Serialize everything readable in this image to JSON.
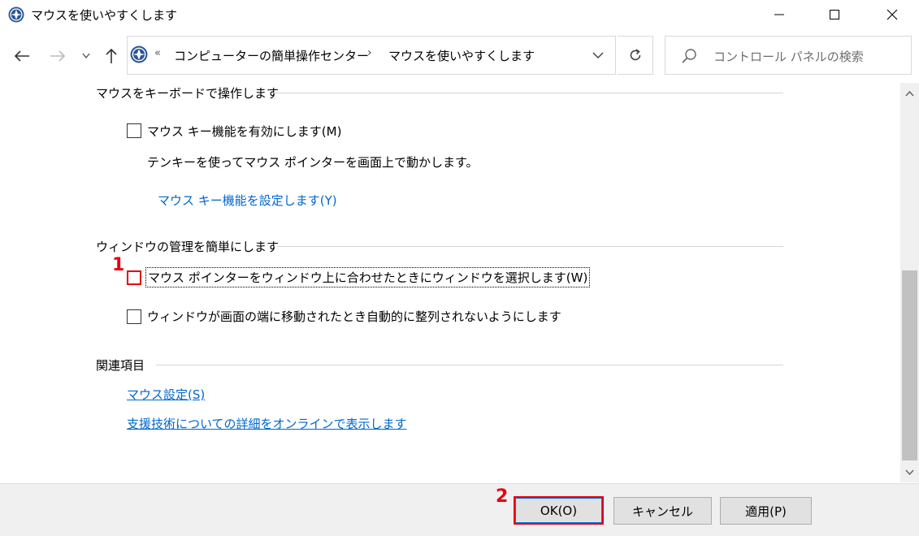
{
  "window": {
    "title": "マウスを使いやすくします",
    "controls": [
      "minimize-icon",
      "maximize-icon",
      "close-icon"
    ]
  },
  "nav": {
    "overflow": "«",
    "breadcrumbs": [
      "コンピューターの簡単操作センター",
      "マウスを使いやすくします"
    ],
    "separator": "›",
    "search_placeholder": "コントロール パネルの検索"
  },
  "sections": {
    "keyboard": {
      "title": "マウスをキーボードで操作します",
      "checkbox_label": "マウス キー機能を有効にします(M)",
      "checkbox_checked": false,
      "description": "テンキーを使ってマウス ポインターを画面上で動かします。",
      "setup_link": "マウス キー機能を設定します(Y)"
    },
    "window_mgmt": {
      "title": "ウィンドウの管理を簡単にします",
      "hover_label": "マウス ポインターをウィンドウ上に合わせたときにウィンドウを選択します(W)",
      "hover_checked": false,
      "snap_label": "ウィンドウが画面の端に移動されたとき自動的に整列されないようにします",
      "snap_checked": false
    },
    "related": {
      "title": "関連項目",
      "links": [
        "マウス設定(S)",
        "支援技術についての詳細をオンラインで表示します"
      ]
    }
  },
  "annotations": {
    "marker_1": "1",
    "marker_2": "2",
    "highlight_color": "#e60012"
  },
  "buttons": {
    "ok": "OK(O)",
    "cancel": "キャンセル",
    "apply": "適用(P)"
  },
  "colors": {
    "link": "#0066cc",
    "accent": "#0078d7"
  }
}
